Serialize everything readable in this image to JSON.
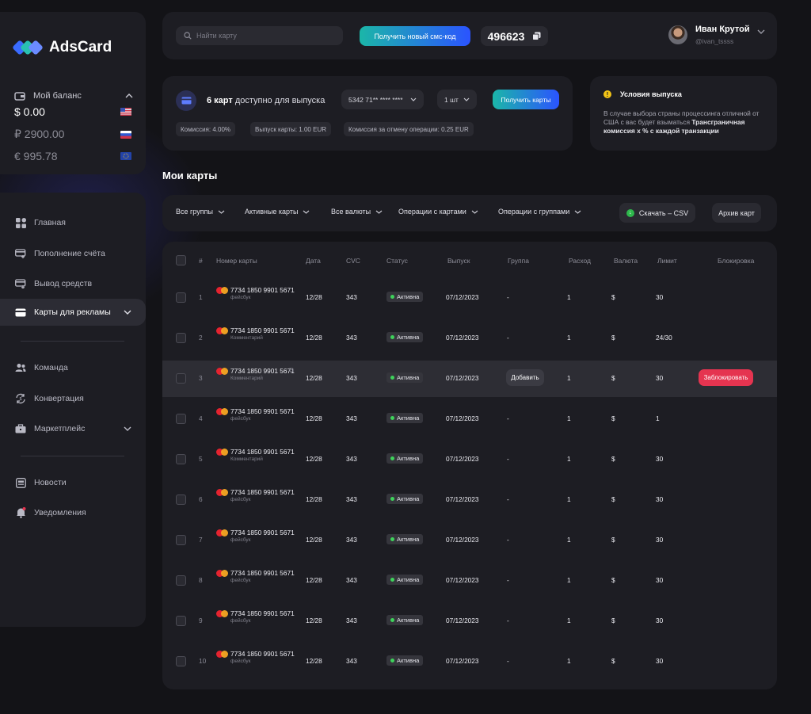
{
  "brand": {
    "name": "AdsCard"
  },
  "balance": {
    "label": "Мой баланс",
    "rows": [
      {
        "amount": "$ 0.00",
        "flag": "us"
      },
      {
        "amount": "₽ 2900.00",
        "flag": "ru"
      },
      {
        "amount": "€ 995.78",
        "flag": "eu"
      }
    ]
  },
  "nav": {
    "home": "Главная",
    "topup": "Пополнение счёта",
    "withdraw": "Вывод средств",
    "ad_cards": "Карты для рекламы",
    "team": "Команда",
    "convert": "Конвертация",
    "market": "Маркетплейс",
    "news": "Новости",
    "notifications": "Уведомления"
  },
  "topbar": {
    "search_placeholder": "Найти карту",
    "sms_button": "Получить новый смс-код",
    "sms_code": "496623",
    "user_name": "Иван Крутой",
    "user_handle": "@ivan_tssss"
  },
  "issue": {
    "count": "6 карт",
    "text": "доступно для выпуска",
    "card_select": "5342 71** **** ****",
    "qty_select": "1 шт",
    "get_button": "Получить карты",
    "fee": "Комиссия: 4.00%",
    "issue_fee": "Выпуск карты: 1.00 EUR",
    "cancel_fee": "Комиссия за отмену операции: 0.25 EUR"
  },
  "conditions": {
    "title": "Условия выпуска",
    "text": "В случае выбора страны процессинга отличной от США с вас будет взыматься",
    "bold": "Трансграничная комиссия х % с каждой транзакции"
  },
  "section_title": "Мои карты",
  "filters": {
    "groups": "Все группы",
    "active": "Активные карты",
    "currencies": "Все валюты",
    "card_ops": "Операции с картами",
    "group_ops": "Операции с группами",
    "csv": "Скачать – CSV",
    "archive": "Архив карт"
  },
  "table": {
    "headers": {
      "num": "#",
      "card": "Номер карты",
      "date": "Дата",
      "cvc": "CVC",
      "status": "Статус",
      "issue": "Выпуск",
      "group": "Группа",
      "spend": "Расход",
      "currency": "Валюта",
      "limit": "Лимит",
      "block": "Блокировка"
    },
    "rows": [
      {
        "n": "1",
        "card": "7734 1850 9901 5671",
        "note": "фейсбук",
        "date": "12/28",
        "cvc": "343",
        "status": "Активна",
        "issued": "07/12/2023",
        "group": "-",
        "spend": "1",
        "currency": "$",
        "limit": "30"
      },
      {
        "n": "2",
        "card": "7734 1850 9901 5671",
        "note": "Комментарий",
        "date": "12/28",
        "cvc": "343",
        "status": "Активна",
        "issued": "07/12/2023",
        "group": "-",
        "spend": "1",
        "currency": "$",
        "limit": "24/30"
      },
      {
        "n": "3",
        "card": "7734 1850 9901 5671",
        "note": "Комментарий",
        "date": "12/28",
        "cvc": "343",
        "status": "Активна",
        "issued": "07/12/2023",
        "group": "Добавить",
        "spend": "1",
        "currency": "$",
        "limit": "30",
        "block": "Заблокировать"
      },
      {
        "n": "4",
        "card": "7734 1850 9901 5671",
        "note": "фейсбук",
        "date": "12/28",
        "cvc": "343",
        "status": "Активна",
        "issued": "07/12/2023",
        "group": "-",
        "spend": "1",
        "currency": "$",
        "limit": "1"
      },
      {
        "n": "5",
        "card": "7734 1850 9901 5671",
        "note": "Комментарий",
        "date": "12/28",
        "cvc": "343",
        "status": "Активна",
        "issued": "07/12/2023",
        "group": "-",
        "spend": "1",
        "currency": "$",
        "limit": "30"
      },
      {
        "n": "6",
        "card": "7734 1850 9901 5671",
        "note": "фейсбук",
        "date": "12/28",
        "cvc": "343",
        "status": "Активна",
        "issued": "07/12/2023",
        "group": "-",
        "spend": "1",
        "currency": "$",
        "limit": "30"
      },
      {
        "n": "7",
        "card": "7734 1850 9901 5671",
        "note": "фейсбук",
        "date": "12/28",
        "cvc": "343",
        "status": "Активна",
        "issued": "07/12/2023",
        "group": "-",
        "spend": "1",
        "currency": "$",
        "limit": "30"
      },
      {
        "n": "8",
        "card": "7734 1850 9901 5671",
        "note": "фейсбук",
        "date": "12/28",
        "cvc": "343",
        "status": "Активна",
        "issued": "07/12/2023",
        "group": "-",
        "spend": "1",
        "currency": "$",
        "limit": "30"
      },
      {
        "n": "9",
        "card": "7734 1850 9901 5671",
        "note": "фейсбук",
        "date": "12/28",
        "cvc": "343",
        "status": "Активна",
        "issued": "07/12/2023",
        "group": "-",
        "spend": "1",
        "currency": "$",
        "limit": "30"
      },
      {
        "n": "10",
        "card": "7734 1850 9901 5671",
        "note": "фейсбук",
        "date": "12/28",
        "cvc": "343",
        "status": "Активна",
        "issued": "07/12/2023",
        "group": "-",
        "spend": "1",
        "currency": "$",
        "limit": "30"
      }
    ]
  },
  "colors": {
    "accent_start": "#1bb6a8",
    "accent_end": "#2b54ff",
    "danger": "#e53450",
    "active": "#3ed25b"
  }
}
